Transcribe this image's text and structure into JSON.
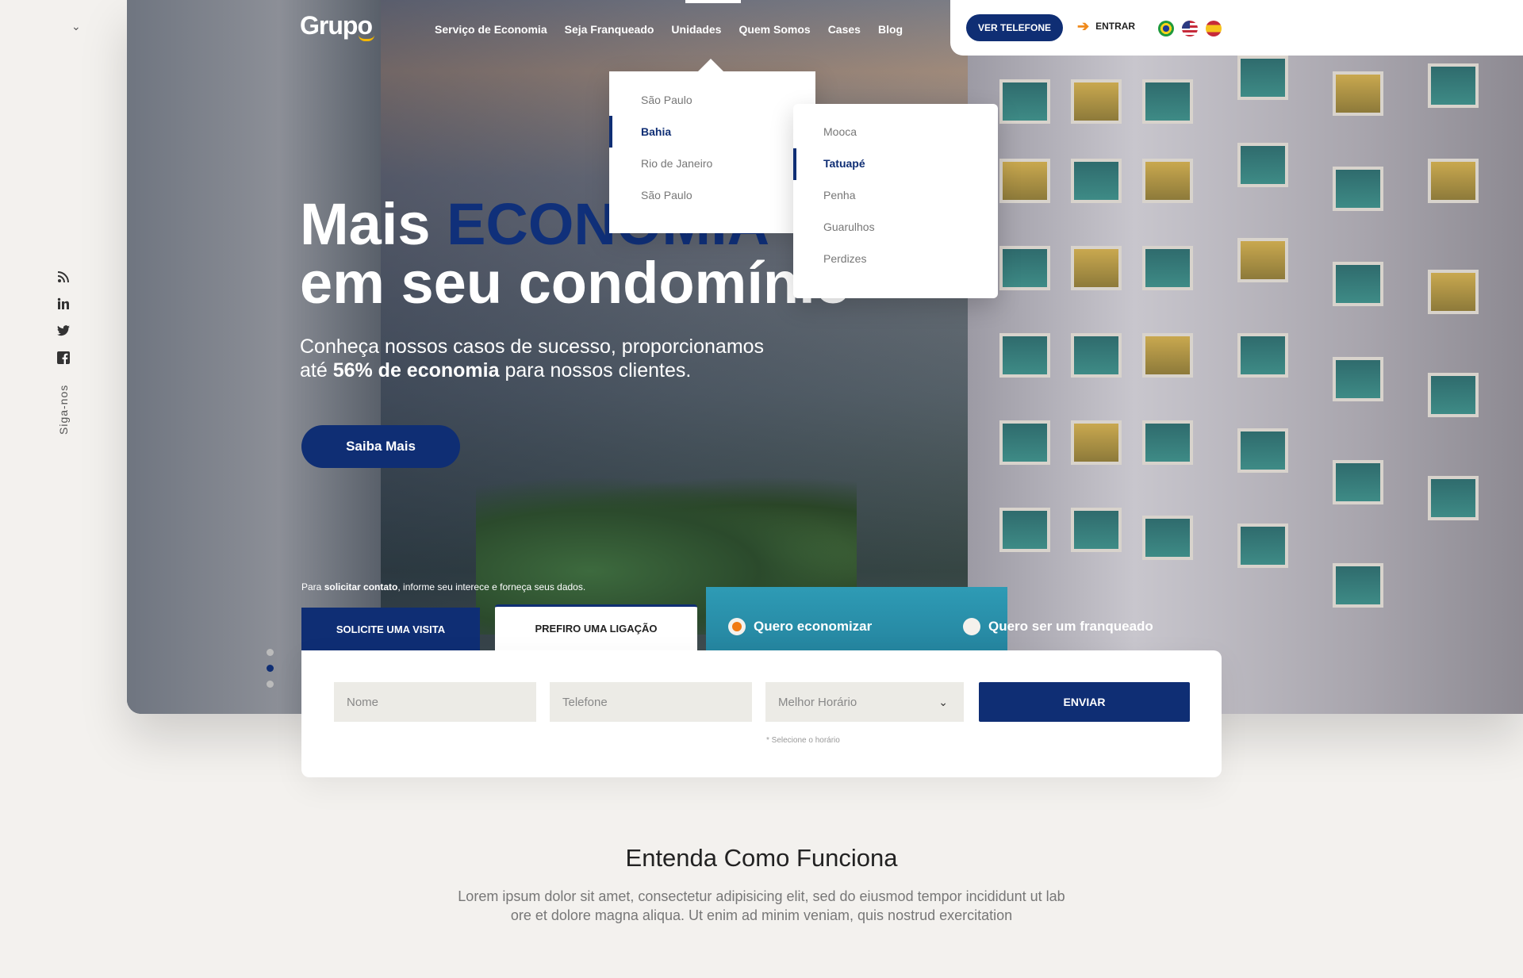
{
  "brand": {
    "logo": "Grupo"
  },
  "nav": {
    "items": [
      "Serviço de Economia",
      "Seja Franqueado",
      "Unidades",
      "Quem Somos",
      "Cases",
      "Blog"
    ],
    "active": "Unidades"
  },
  "topbar": {
    "phone_button": "VER TELEFONE",
    "login_label": "ENTRAR",
    "languages": [
      "pt-BR",
      "en-US",
      "es-ES"
    ]
  },
  "dropdown": {
    "states": [
      {
        "label": "São Paulo",
        "active": false
      },
      {
        "label": "Bahia",
        "active": true
      },
      {
        "label": "Rio de Janeiro",
        "active": false
      },
      {
        "label": "São Paulo",
        "active": false
      }
    ],
    "units": [
      {
        "label": "Mooca",
        "active": false
      },
      {
        "label": "Tatuapé",
        "active": true
      },
      {
        "label": "Penha",
        "active": false
      },
      {
        "label": "Guarulhos",
        "active": false
      },
      {
        "label": "Perdizes",
        "active": false
      }
    ]
  },
  "hero": {
    "title_line1_a": "Mais ",
    "title_line1_b": "ECONOMIA",
    "title_line2": "em seu condomínio",
    "subtitle_line1": "Conheça nossos casos de sucesso, proporcionamos",
    "subtitle_line2_a": "até ",
    "subtitle_line2_b": "56% de economia",
    "subtitle_line2_c": " para nossos clientes.",
    "cta": "Saiba Mais"
  },
  "sidebar": {
    "follow_label": "Siga-nos",
    "social_icons": [
      "rss-icon",
      "linkedin-icon",
      "twitter-icon",
      "facebook-icon"
    ]
  },
  "contact": {
    "note_a": "Para ",
    "note_b": "solicitar contato",
    "note_c": ", informe seu interece e forneça seus dados.",
    "tabs": [
      "SOLICITE UMA VISITA",
      "PREFIRO UMA LIGAÇÃO"
    ],
    "active_tab": "PREFIRO UMA LIGAÇÃO",
    "radio_options": [
      {
        "label": "Quero economizar",
        "checked": true
      },
      {
        "label": "Quero ser um franqueado",
        "checked": false
      }
    ],
    "fields": {
      "name_placeholder": "Nome",
      "phone_placeholder": "Telefone",
      "time_placeholder": "Melhor Horário"
    },
    "submit": "ENVIAR",
    "hint": "* Selecione o horário"
  },
  "section": {
    "title": "Entenda Como Funciona",
    "text_line1": "Lorem ipsum dolor sit amet, consectetur adipisicing elit, sed do eiusmod tempor incididunt ut lab",
    "text_line2": "ore et dolore magna aliqua. Ut enim ad minim veniam, quis nostrud exercitation"
  },
  "slider": {
    "count": 3,
    "active_index": 1
  },
  "colors": {
    "primary": "#0f2e74",
    "accent": "#f07a12",
    "logo_smile": "#f5b800"
  }
}
